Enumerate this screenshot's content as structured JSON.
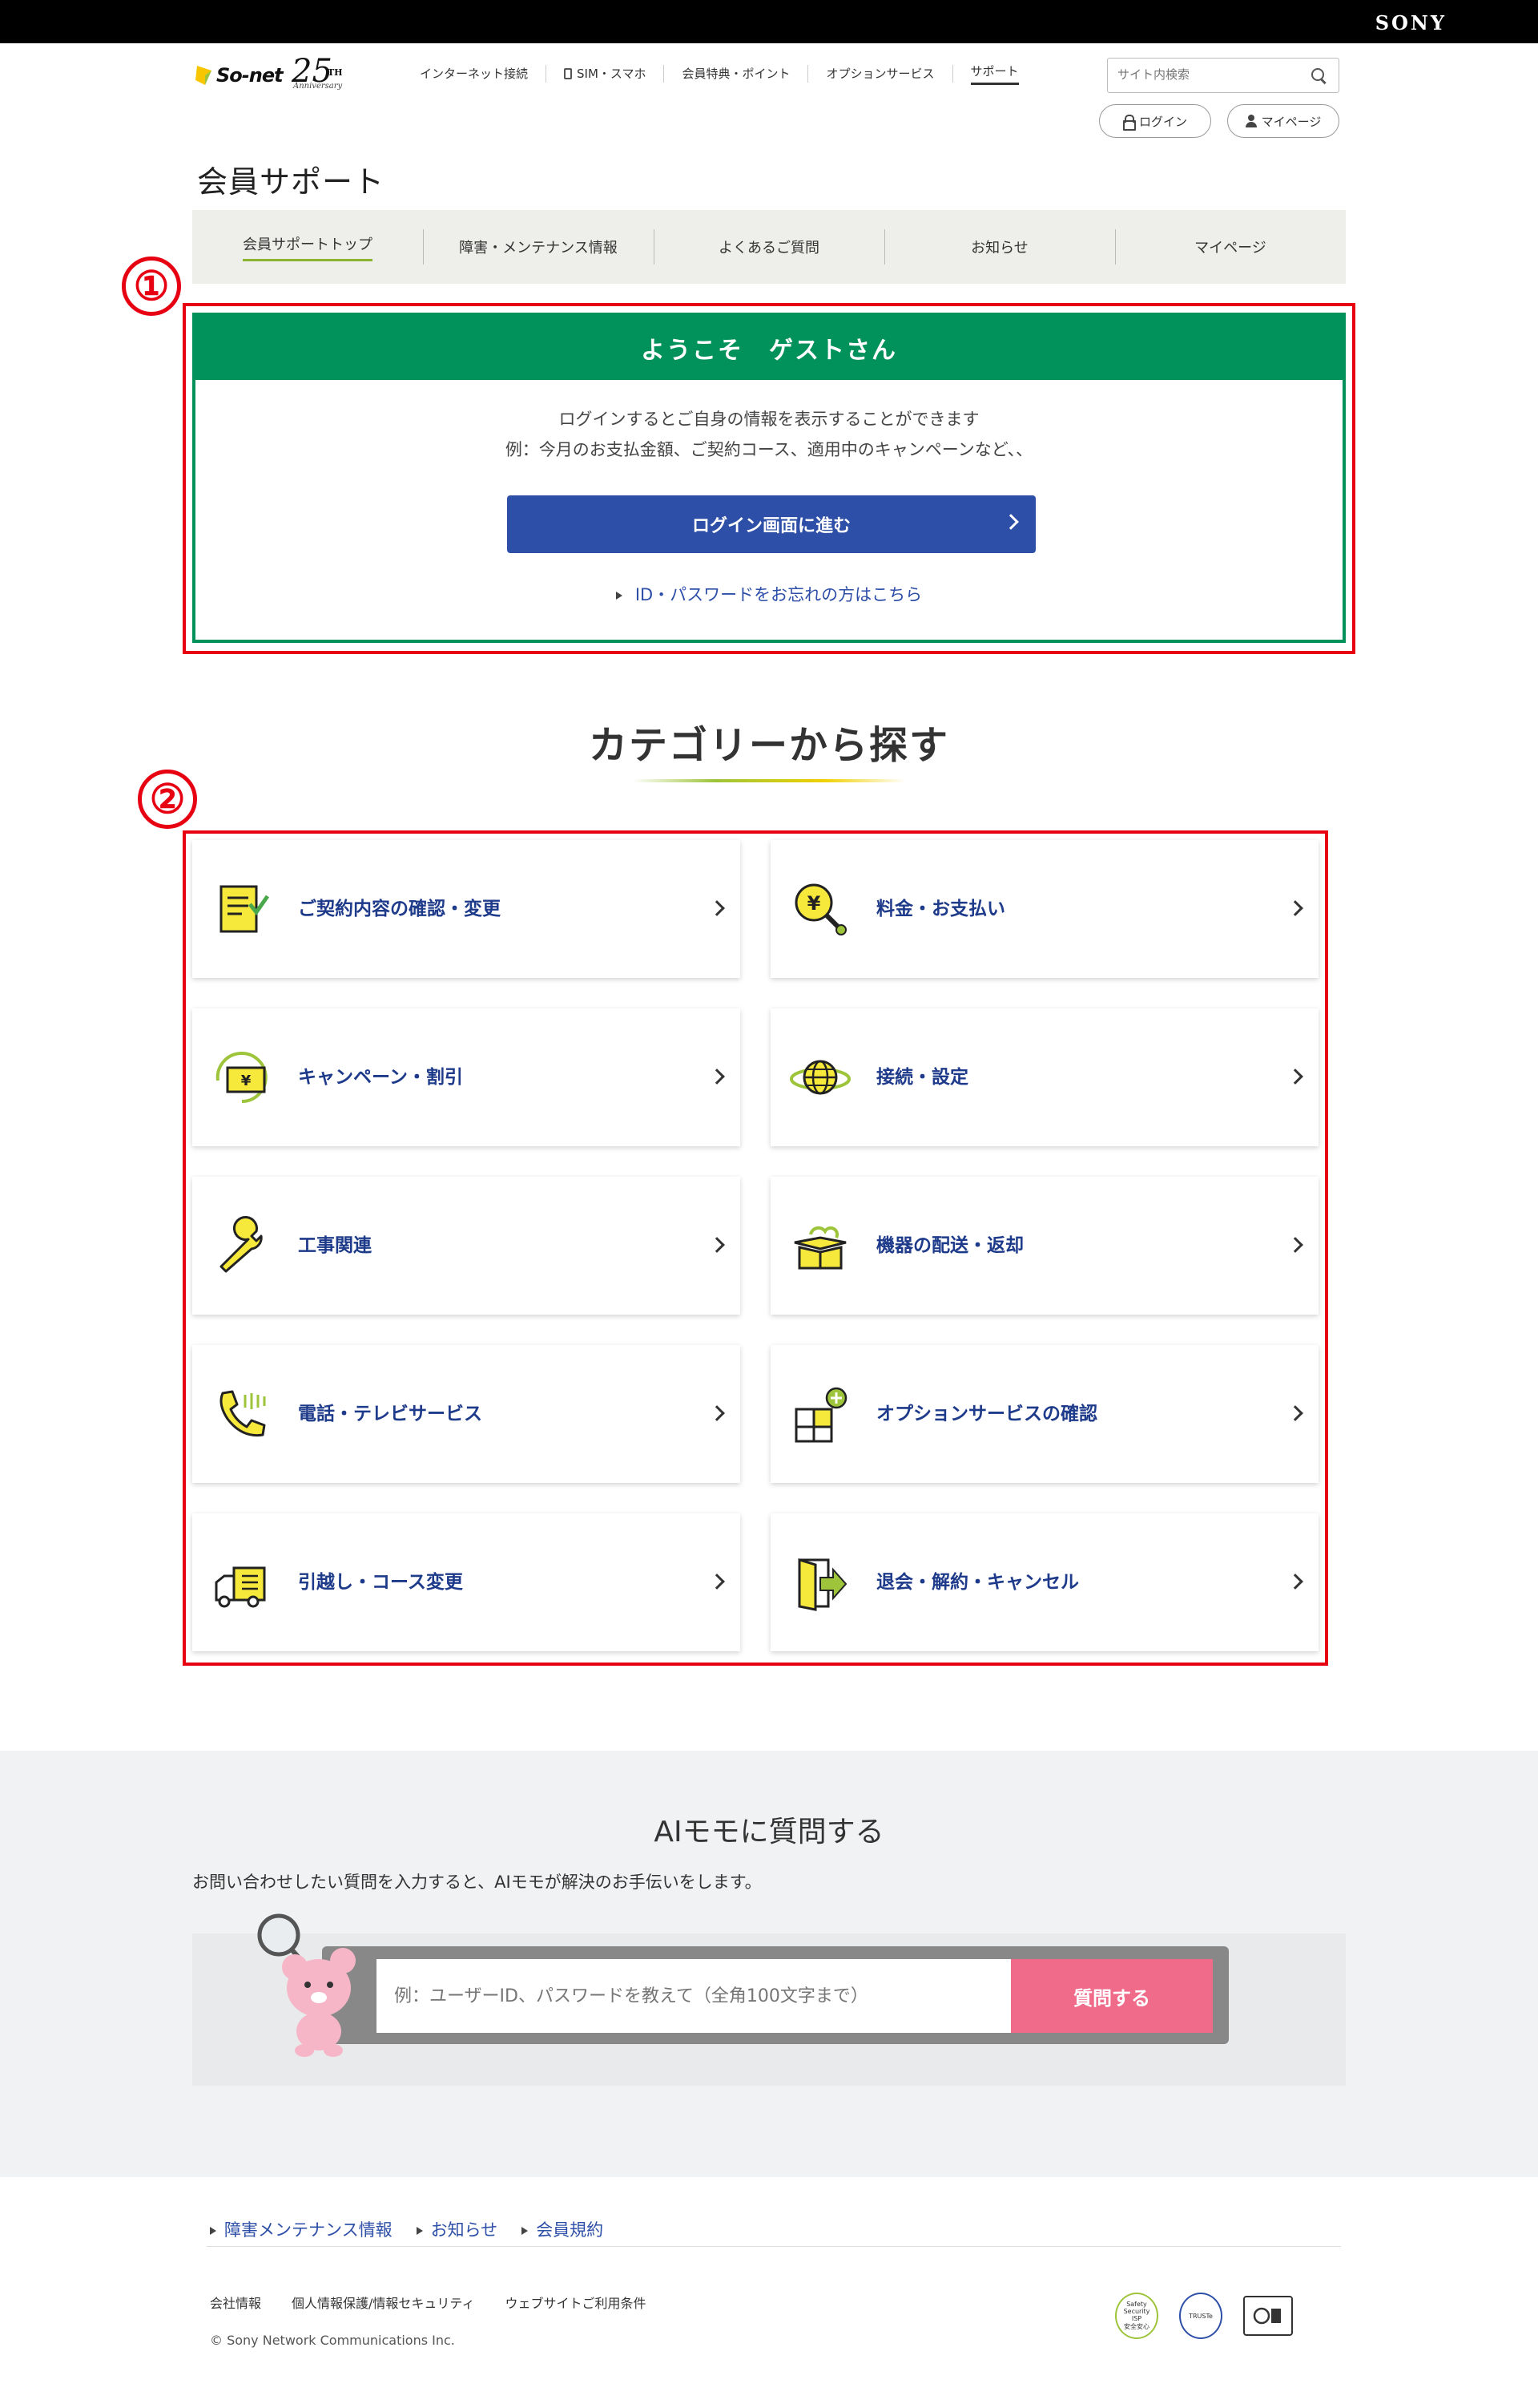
{
  "sony_logo": "SONY",
  "logo": {
    "brand": "So-net",
    "anniversary_number": "25",
    "anniversary_suffix": "TH",
    "anniversary_word": "Anniversary"
  },
  "global_nav": [
    {
      "label": "インターネット接続"
    },
    {
      "label": "SIM・スマホ"
    },
    {
      "label": "会員特典・ポイント"
    },
    {
      "label": "オプションサービス"
    },
    {
      "label": "サポート",
      "active": true
    }
  ],
  "search": {
    "placeholder": "サイト内検索"
  },
  "header_buttons": {
    "login": "ログイン",
    "mypage": "マイページ"
  },
  "page_title": "会員サポート",
  "sub_nav": [
    {
      "label": "会員サポートトップ",
      "active": true
    },
    {
      "label": "障害・メンテナンス情報"
    },
    {
      "label": "よくあるご質問"
    },
    {
      "label": "お知らせ"
    },
    {
      "label": "マイページ"
    }
  ],
  "annotations": {
    "one": "①",
    "two": "②",
    "color": "#e60012"
  },
  "welcome": {
    "heading": "ようこそ　ゲストさん",
    "line1": "ログインするとご自身の情報を表示することができます",
    "line2": "例：今月のお支払金額、ご契約コース、適用中のキャンペーンなど、、",
    "login_button": "ログイン画面に進む",
    "forgot_link": "ID・パスワードをお忘れの方はこちら",
    "accent_color": "#00925a",
    "button_color": "#2e4fa8"
  },
  "category_title": "カテゴリーから探す",
  "categories": [
    {
      "label": "ご契約内容の確認・変更",
      "icon": "contract-document-icon"
    },
    {
      "label": "料金・お支払い",
      "icon": "yen-magnifier-icon"
    },
    {
      "label": "キャンペーン・割引",
      "icon": "campaign-yen-icon"
    },
    {
      "label": "接続・設定",
      "icon": "globe-connection-icon"
    },
    {
      "label": "工事関連",
      "icon": "wrench-icon"
    },
    {
      "label": "機器の配送・返却",
      "icon": "delivery-box-icon"
    },
    {
      "label": "電話・テレビサービス",
      "icon": "phone-icon"
    },
    {
      "label": "オプションサービスの確認",
      "icon": "puzzle-plus-icon"
    },
    {
      "label": "引越し・コース変更",
      "icon": "moving-truck-icon"
    },
    {
      "label": "退会・解約・キャンセル",
      "icon": "exit-door-icon"
    }
  ],
  "ai": {
    "title": "AIモモに質問する",
    "description": "お問い合わせしたい質問を入力すると、AIモモが解決のお手伝いをします。",
    "placeholder": "例：ユーザーID、パスワードを教えて（全角100文字まで）",
    "button": "質問する",
    "button_color": "#f06a8a"
  },
  "footer": {
    "links": [
      "障害メンテナンス情報",
      "お知らせ",
      "会員規約"
    ],
    "sub_links": [
      "会社情報",
      "個人情報保護/情報セキュリティ",
      "ウェブサイトご利用条件"
    ],
    "copyright": "© Sony Network Communications Inc.",
    "badge1_lines": [
      "Safety",
      "Security",
      "ISP",
      "安全安心"
    ],
    "badge2_text": "TRUSTe"
  }
}
